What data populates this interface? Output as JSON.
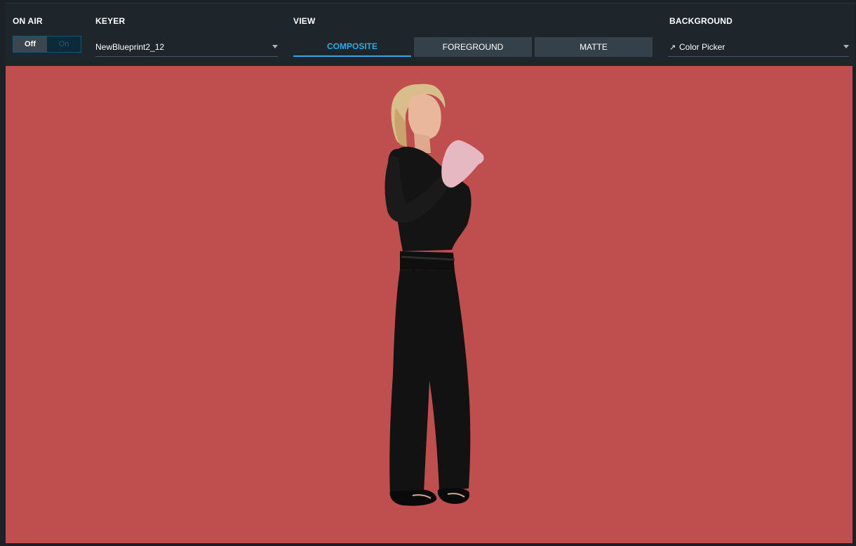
{
  "toolbar": {
    "on_air": {
      "label": "ON AIR",
      "off_label": "Off",
      "on_label": "On",
      "selected": "Off"
    },
    "keyer": {
      "label": "KEYER",
      "value": "NewBlueprint2_12"
    },
    "view": {
      "label": "VIEW",
      "tabs": [
        {
          "label": "COMPOSITE",
          "active": true
        },
        {
          "label": "FOREGROUND",
          "active": false
        },
        {
          "label": "MATTE",
          "active": false
        }
      ]
    },
    "background": {
      "label": "BACKGROUND",
      "value": "Color Picker",
      "icon": "eyedropper-icon"
    }
  },
  "preview": {
    "background_color": "#bf4f4e",
    "subject": "standing-woman-image"
  },
  "colors": {
    "accent": "#2fa8e8",
    "toolbar": "#1e252b",
    "tab_inactive": "#35414a"
  }
}
